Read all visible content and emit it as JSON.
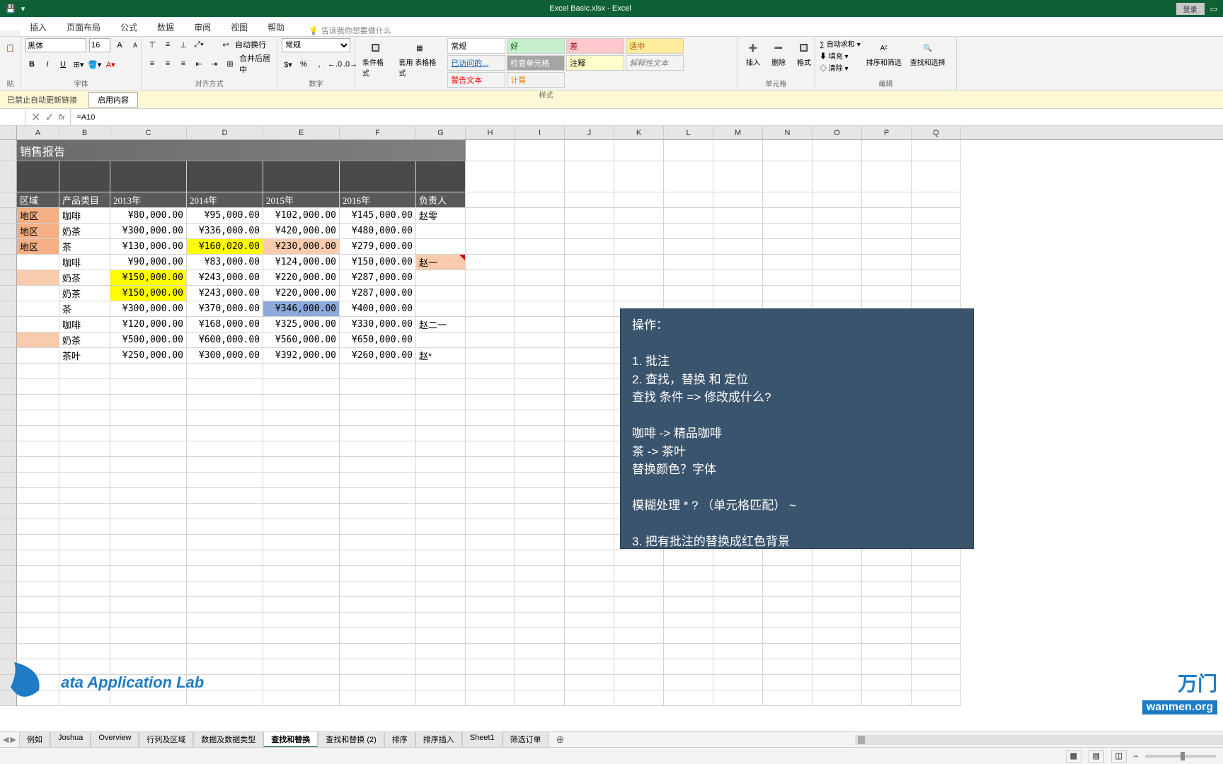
{
  "title": "Excel Basic.xlsx - Excel",
  "login": "登录",
  "ribbon_tabs": [
    "",
    "插入",
    "页面布局",
    "公式",
    "数据",
    "审阅",
    "视图",
    "帮助"
  ],
  "tell_me": "告诉我你想要做什么",
  "font": {
    "name": "黑体",
    "size": "16"
  },
  "align": {
    "wrap": "自动换行",
    "merge": "合并后居中"
  },
  "number_format": "常规",
  "styles_btns": {
    "cond": "条件格式",
    "table": "套用\n表格格式"
  },
  "style_gallery": {
    "r1": [
      "常规",
      "好",
      "差",
      "适中",
      "已访问的..."
    ],
    "r2": [
      "检查单元格",
      "注释",
      "解释性文本",
      "警告文本",
      "计算"
    ]
  },
  "cells_btns": [
    "插入",
    "删除",
    "格式"
  ],
  "editing": {
    "autosum": "自动求和",
    "fill": "填充",
    "clear": "清除",
    "sort": "排序和筛选",
    "find": "查找和选择"
  },
  "group_labels": {
    "font": "字体",
    "align": "对齐方式",
    "number": "数字",
    "styles": "样式",
    "cells": "单元格",
    "editing": "编辑"
  },
  "msg_bar": {
    "text": "已禁止自动更新链接",
    "btn": "启用内容"
  },
  "formula": "=A10",
  "cols": [
    "A",
    "B",
    "C",
    "D",
    "E",
    "F",
    "G",
    "H",
    "I",
    "J",
    "K",
    "L",
    "M",
    "N",
    "O",
    "P",
    "Q"
  ],
  "title_row": "销售报告",
  "headers": {
    "A": "区域",
    "B": "产品类目",
    "C": "2013年",
    "D": "2014年",
    "E": "2015年",
    "F": "2016年",
    "G": "负责人"
  },
  "rows": [
    {
      "A": "地区",
      "B": "咖啡",
      "C": "¥80,000.00",
      "D": "¥95,000.00",
      "E": "¥102,000.00",
      "F": "¥145,000.00",
      "G": "赵零",
      "Ahi": "orange"
    },
    {
      "A": "地区",
      "B": "奶茶",
      "C": "¥300,000.00",
      "D": "¥336,000.00",
      "E": "¥420,000.00",
      "F": "¥480,000.00",
      "G": "",
      "Ahi": "orange"
    },
    {
      "A": "地区",
      "B": "茶",
      "C": "¥130,000.00",
      "D": "¥160,020.00",
      "E": "¥230,000.00",
      "F": "¥279,000.00",
      "G": "",
      "Ahi": "orange",
      "Dhi": "yellow",
      "Ehi": "ltorange"
    },
    {
      "A": "",
      "B": "咖啡",
      "C": "¥90,000.00",
      "D": "¥83,000.00",
      "E": "¥124,000.00",
      "F": "¥150,000.00",
      "G": "赵一",
      "Ghi": "ltorange",
      "Gtri": true
    },
    {
      "A": "",
      "B": "奶茶",
      "C": "¥150,000.00",
      "D": "¥243,000.00",
      "E": "¥220,000.00",
      "F": "¥287,000.00",
      "G": "",
      "Ahi": "ltorange",
      "Chi": "yellow"
    },
    {
      "A": "",
      "B": "奶茶",
      "C": "¥150,000.00",
      "D": "¥243,000.00",
      "E": "¥220,000.00",
      "F": "¥287,000.00",
      "G": "",
      "Chi": "yellow"
    },
    {
      "A": "",
      "B": "茶",
      "C": "¥300,000.00",
      "D": "¥370,000.00",
      "E": "¥346,000.00",
      "F": "¥400,000.00",
      "G": "",
      "Ehi": "blue"
    },
    {
      "A": "",
      "B": "咖啡",
      "C": "¥120,000.00",
      "D": "¥168,000.00",
      "E": "¥325,000.00",
      "F": "¥330,000.00",
      "G": "赵二一"
    },
    {
      "A": "",
      "B": "奶茶",
      "C": "¥500,000.00",
      "D": "¥600,000.00",
      "E": "¥560,000.00",
      "F": "¥650,000.00",
      "G": "",
      "Ahi": "ltorange"
    },
    {
      "A": "",
      "B": "茶叶",
      "C": "¥250,000.00",
      "D": "¥300,000.00",
      "E": "¥392,000.00",
      "F": "¥260,000.00",
      "G": "赵*"
    }
  ],
  "textbox": {
    "l1": "操作：",
    "l2": "",
    "l3": "1. 批注",
    "l4": "2. 查找，替换 和 定位",
    "l5": "查找 条件 => 修改成什么?",
    "l6": "",
    "l7": "咖啡 ->  精品咖啡",
    "l8": "茶    ->  茶叶",
    "l9": "替换颜色？字体",
    "l10": "",
    "l11": "模糊处理   *   ?  （单元格匹配）  ~",
    "l12": "",
    "l13": "3. 把有批注的替换成红色背景"
  },
  "sheet_tabs": [
    "例如",
    "Joshua",
    "Overview",
    "行列及区域",
    "数据及数据类型",
    "查找和替换",
    "查找和替换 (2)",
    "排序",
    "排序插入",
    "Sheet1",
    "筛选订单"
  ],
  "active_sheet": 5,
  "watermark_left": "ata Application Lab",
  "watermark_brand": "万门",
  "watermark_url": "wanmen.org"
}
